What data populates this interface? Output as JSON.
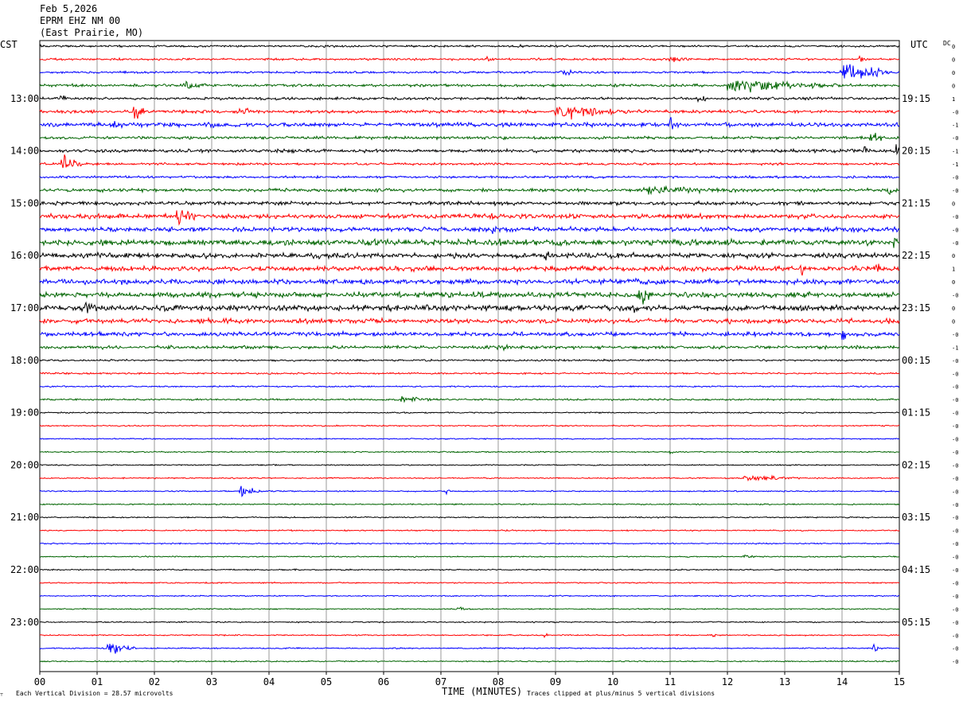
{
  "header": {
    "date": "Feb 5,2026",
    "station": "EPRM EHZ NM 00",
    "location": "(East Prairie, MO)"
  },
  "left_timezone": "CST",
  "right_timezone": "UTC",
  "dc_label": "DC",
  "footer": {
    "scale_note": "Each Vertical Division =   28.57 microvolts",
    "xlabel": "TIME (MINUTES)",
    "clip_note": "Traces clipped at plus/minus 5 vertical divisions"
  },
  "colors": {
    "black": "#000000",
    "red": "#ff0000",
    "blue": "#0000ff",
    "green": "#006400",
    "grid": "#7f7f7f"
  },
  "chart_data": {
    "type": "line",
    "title": "EPRM EHZ NM 00",
    "xlabel": "TIME (MINUTES)",
    "xlim": [
      0,
      15
    ],
    "x_ticks": [
      "00",
      "01",
      "02",
      "03",
      "04",
      "05",
      "06",
      "07",
      "08",
      "09",
      "10",
      "11",
      "12",
      "13",
      "14",
      "15"
    ],
    "trace_count": 48,
    "trace_color_cycle": [
      "black",
      "red",
      "blue",
      "green"
    ],
    "left_hour_labels": [
      {
        "trace": 4,
        "label": "13:00"
      },
      {
        "trace": 8,
        "label": "14:00"
      },
      {
        "trace": 12,
        "label": "15:00"
      },
      {
        "trace": 16,
        "label": "16:00"
      },
      {
        "trace": 20,
        "label": "17:00"
      },
      {
        "trace": 24,
        "label": "18:00"
      },
      {
        "trace": 28,
        "label": "19:00"
      },
      {
        "trace": 32,
        "label": "20:00"
      },
      {
        "trace": 36,
        "label": "21:00"
      },
      {
        "trace": 40,
        "label": "22:00"
      },
      {
        "trace": 44,
        "label": "23:00"
      }
    ],
    "right_hour_labels": [
      {
        "trace": 4,
        "label": "19:15"
      },
      {
        "trace": 8,
        "label": "20:15"
      },
      {
        "trace": 12,
        "label": "21:15"
      },
      {
        "trace": 16,
        "label": "22:15"
      },
      {
        "trace": 20,
        "label": "23:15"
      },
      {
        "trace": 24,
        "label": "00:15"
      },
      {
        "trace": 28,
        "label": "01:15"
      },
      {
        "trace": 32,
        "label": "02:15"
      },
      {
        "trace": 36,
        "label": "03:15"
      },
      {
        "trace": 40,
        "label": "04:15"
      },
      {
        "trace": 44,
        "label": "05:15"
      }
    ],
    "dc_offsets": [
      "0",
      "0",
      "0",
      "0",
      "1",
      "-0",
      "-1",
      "-0",
      "-1",
      "-1",
      "-0",
      "-0",
      "0",
      "-0",
      "-0",
      "-0",
      "0",
      "1",
      "0",
      "-0",
      "0",
      "0",
      "-0",
      "-1",
      "-0",
      "-0",
      "-0",
      "-0",
      "-0",
      "-0",
      "-0",
      "-0",
      "-0",
      "-0",
      "-0",
      "-0",
      "-0",
      "-0",
      "-0",
      "-0",
      "-0",
      "-0",
      "-0",
      "-0",
      "-0",
      "-0",
      "-0",
      "-0"
    ],
    "noise_levels": [
      1.0,
      1.0,
      1.0,
      1.3,
      1.3,
      1.5,
      2.0,
      1.4,
      1.6,
      1.1,
      1.1,
      1.6,
      1.8,
      2.2,
      2.2,
      2.8,
      2.5,
      2.5,
      2.4,
      2.7,
      2.8,
      2.3,
      2.1,
      1.6,
      0.9,
      0.8,
      0.7,
      0.8,
      0.6,
      0.6,
      0.6,
      0.6,
      0.6,
      0.6,
      0.6,
      0.6,
      0.6,
      0.6,
      0.6,
      0.6,
      0.6,
      0.6,
      0.6,
      0.6,
      0.6,
      0.6,
      0.6,
      0.6
    ],
    "events": [
      {
        "trace": 0,
        "minute": 8.4,
        "duration": 0.08,
        "amplitude": 4
      },
      {
        "trace": 1,
        "minute": 7.8,
        "duration": 0.25,
        "amplitude": 4
      },
      {
        "trace": 1,
        "minute": 11.0,
        "duration": 0.7,
        "amplitude": 4
      },
      {
        "trace": 1,
        "minute": 14.3,
        "duration": 0.4,
        "amplitude": 3
      },
      {
        "trace": 2,
        "minute": 9.1,
        "duration": 0.4,
        "amplitude": 5
      },
      {
        "trace": 2,
        "minute": 14.0,
        "duration": 1.1,
        "amplitude": 12
      },
      {
        "trace": 3,
        "minute": 12.0,
        "duration": 2.6,
        "amplitude": 9
      },
      {
        "trace": 3,
        "minute": 2.5,
        "duration": 1.0,
        "amplitude": 4
      },
      {
        "trace": 4,
        "minute": 0.3,
        "duration": 0.6,
        "amplitude": 4
      },
      {
        "trace": 4,
        "minute": 11.5,
        "duration": 0.3,
        "amplitude": 5
      },
      {
        "trace": 5,
        "minute": 1.65,
        "duration": 0.25,
        "amplitude": 13
      },
      {
        "trace": 5,
        "minute": 9.0,
        "duration": 1.5,
        "amplitude": 11
      },
      {
        "trace": 5,
        "minute": 3.5,
        "duration": 0.6,
        "amplitude": 5
      },
      {
        "trace": 6,
        "minute": 1.3,
        "duration": 0.4,
        "amplitude": 6
      },
      {
        "trace": 6,
        "minute": 3.0,
        "duration": 0.5,
        "amplitude": 6
      },
      {
        "trace": 6,
        "minute": 11.0,
        "duration": 0.3,
        "amplitude": 7
      },
      {
        "trace": 7,
        "minute": 14.5,
        "duration": 0.6,
        "amplitude": 6
      },
      {
        "trace": 8,
        "minute": 14.4,
        "duration": 0.3,
        "amplitude": 6
      },
      {
        "trace": 8,
        "minute": 14.95,
        "duration": 0.08,
        "amplitude": 12
      },
      {
        "trace": 9,
        "minute": 0.4,
        "duration": 0.45,
        "amplitude": 11
      },
      {
        "trace": 11,
        "minute": 10.5,
        "duration": 5.0,
        "amplitude": 4
      },
      {
        "trace": 11,
        "minute": 14.8,
        "duration": 0.3,
        "amplitude": 6
      },
      {
        "trace": 12,
        "minute": 8.5,
        "duration": 0.3,
        "amplitude": 5
      },
      {
        "trace": 13,
        "minute": 2.4,
        "duration": 0.5,
        "amplitude": 13
      },
      {
        "trace": 13,
        "minute": 7.9,
        "duration": 0.5,
        "amplitude": 6
      },
      {
        "trace": 14,
        "minute": 7.9,
        "duration": 0.3,
        "amplitude": 6
      },
      {
        "trace": 15,
        "minute": 7.9,
        "duration": 0.6,
        "amplitude": 8
      },
      {
        "trace": 15,
        "minute": 14.9,
        "duration": 0.2,
        "amplitude": 8
      },
      {
        "trace": 16,
        "minute": 8.8,
        "duration": 0.35,
        "amplitude": 7
      },
      {
        "trace": 17,
        "minute": 13.3,
        "duration": 0.3,
        "amplitude": 7
      },
      {
        "trace": 17,
        "minute": 14.6,
        "duration": 0.5,
        "amplitude": 6
      },
      {
        "trace": 18,
        "minute": 10.4,
        "duration": 0.3,
        "amplitude": 8
      },
      {
        "trace": 19,
        "minute": 10.45,
        "duration": 0.4,
        "amplitude": 14
      },
      {
        "trace": 20,
        "minute": 0.8,
        "duration": 0.6,
        "amplitude": 8
      },
      {
        "trace": 20,
        "minute": 10.3,
        "duration": 0.7,
        "amplitude": 7
      },
      {
        "trace": 21,
        "minute": 12.0,
        "duration": 0.3,
        "amplitude": 5
      },
      {
        "trace": 22,
        "minute": 14.0,
        "duration": 0.2,
        "amplitude": 8
      },
      {
        "trace": 23,
        "minute": 8.0,
        "duration": 0.5,
        "amplitude": 5
      },
      {
        "trace": 25,
        "minute": 4.0,
        "duration": 0.5,
        "amplitude": 2
      },
      {
        "trace": 27,
        "minute": 6.3,
        "duration": 1.1,
        "amplitude": 4
      },
      {
        "trace": 31,
        "minute": 11.0,
        "duration": 0.3,
        "amplitude": 3
      },
      {
        "trace": 33,
        "minute": 12.3,
        "duration": 1.4,
        "amplitude": 4
      },
      {
        "trace": 34,
        "minute": 3.5,
        "duration": 0.4,
        "amplitude": 9
      },
      {
        "trace": 34,
        "minute": 7.1,
        "duration": 0.2,
        "amplitude": 3
      },
      {
        "trace": 39,
        "minute": 12.3,
        "duration": 0.4,
        "amplitude": 3
      },
      {
        "trace": 40,
        "minute": 4.45,
        "duration": 0.06,
        "amplitude": 6
      },
      {
        "trace": 43,
        "minute": 7.3,
        "duration": 0.7,
        "amplitude": 2
      },
      {
        "trace": 45,
        "minute": 8.8,
        "duration": 0.15,
        "amplitude": 4
      },
      {
        "trace": 45,
        "minute": 11.75,
        "duration": 0.08,
        "amplitude": 5
      },
      {
        "trace": 46,
        "minute": 1.2,
        "duration": 0.5,
        "amplitude": 10
      },
      {
        "trace": 46,
        "minute": 14.55,
        "duration": 0.15,
        "amplitude": 8
      }
    ]
  }
}
